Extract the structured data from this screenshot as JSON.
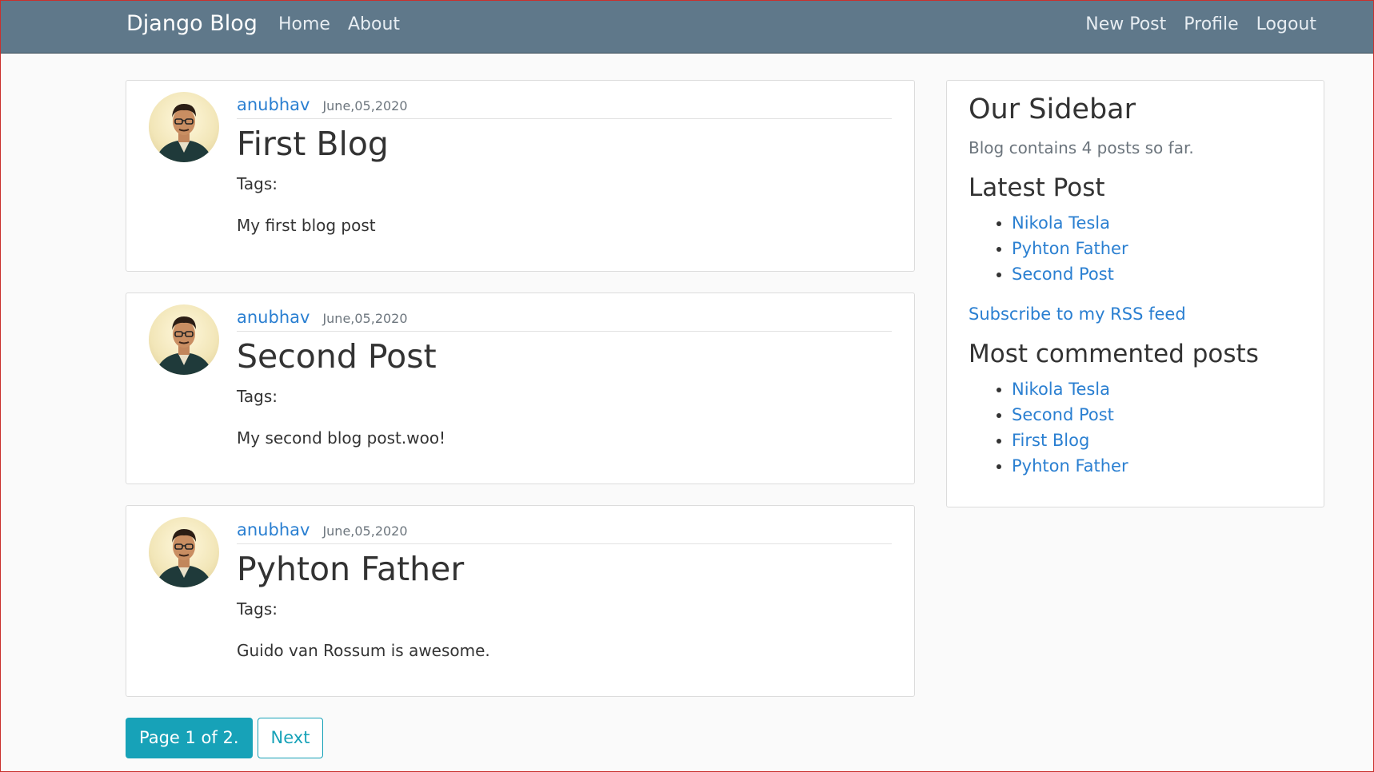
{
  "navbar": {
    "brand": "Django Blog",
    "left_links": [
      "Home",
      "About"
    ],
    "right_links": [
      "New Post",
      "Profile",
      "Logout"
    ]
  },
  "posts": [
    {
      "author": "anubhav",
      "date": "June,05,2020",
      "title": "First Blog",
      "tags_label": "Tags:",
      "content": "My first blog post"
    },
    {
      "author": "anubhav",
      "date": "June,05,2020",
      "title": "Second Post",
      "tags_label": "Tags:",
      "content": "My second blog post.woo!"
    },
    {
      "author": "anubhav",
      "date": "June,05,2020",
      "title": "Pyhton Father",
      "tags_label": "Tags:",
      "content": "Guido van Rossum is awesome."
    }
  ],
  "pagination": {
    "current": "Page 1 of 2.",
    "next": "Next"
  },
  "sidebar": {
    "title": "Our Sidebar",
    "count_text": "Blog contains 4 posts so far.",
    "latest_heading": "Latest Post",
    "latest_posts": [
      "Nikola Tesla",
      "Pyhton Father",
      "Second Post"
    ],
    "rss_link": "Subscribe to my RSS feed",
    "most_commented_heading": "Most commented posts",
    "most_commented": [
      "Nikola Tesla",
      "Second Post",
      "First Blog",
      "Pyhton Father"
    ]
  },
  "colors": {
    "navbar": "#5f788a",
    "link": "#2a7fd1",
    "button": "#17a2b8"
  }
}
